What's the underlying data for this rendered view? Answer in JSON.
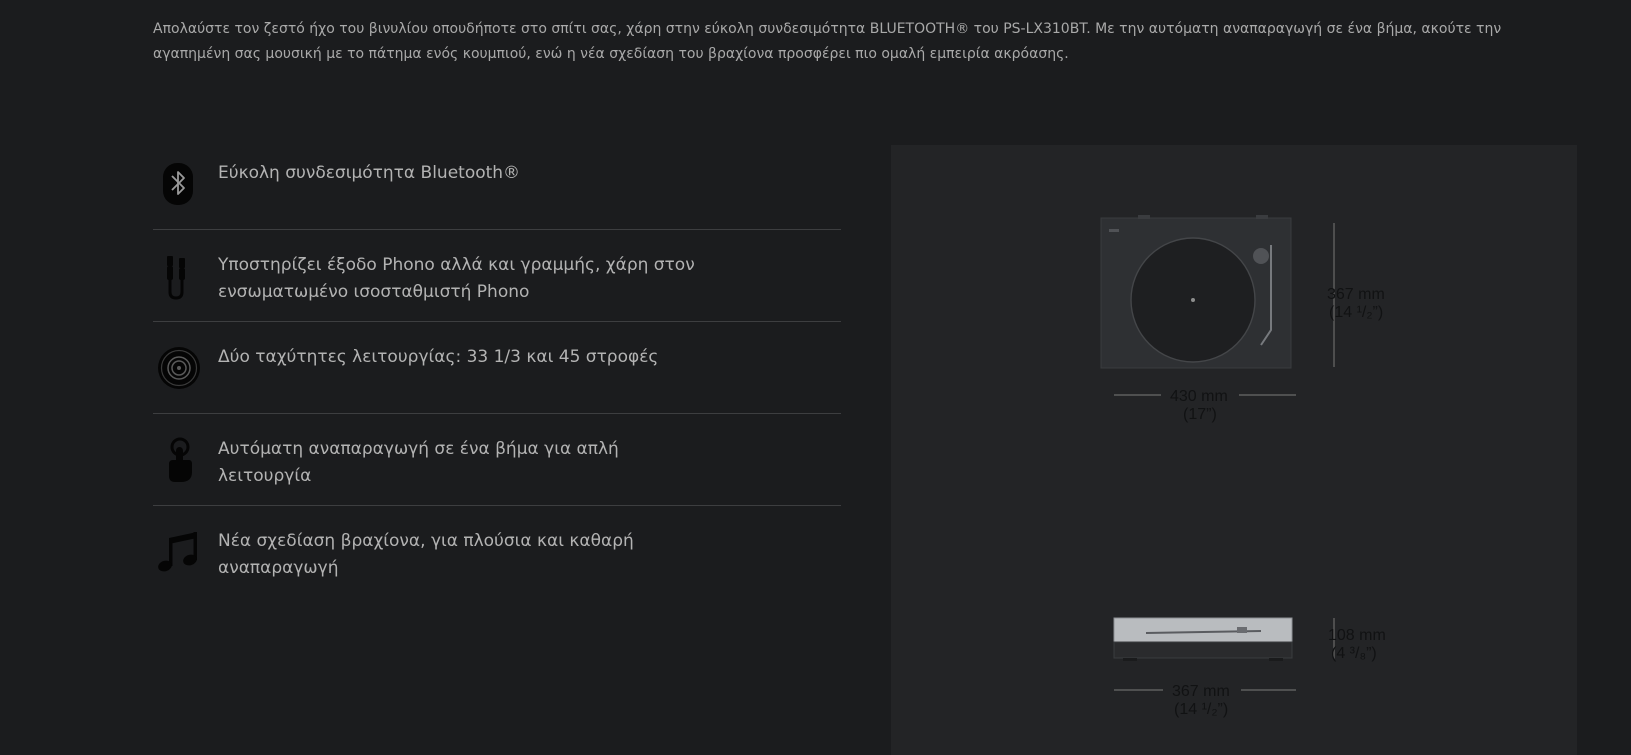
{
  "intro": {
    "text": "Απολαύστε τον ζεστό ήχο του βινυλίου οπουδήποτε στο σπίτι σας, χάρη στην εύκολη συνδεσιμότητα BLUETOOTH® του PS-LX310BT. Με την αυτόματη αναπαραγωγή σε ένα βήμα, ακούτε την αγαπημένη σας μουσική με το πάτημα ενός κουμπιού, ενώ η νέα σχεδίαση του βραχίονα προσφέρει πιο ομαλή εμπειρία ακρόασης."
  },
  "features": [
    {
      "icon": "bluetooth-icon",
      "text": "Εύκολη συνδεσιμότητα Bluetooth®"
    },
    {
      "icon": "phono-cable-icon",
      "text": "Υποστηρίζει έξοδο Phono αλλά και γραμμής, χάρη στον ενσωματωμένο ισοσταθμιστή Phono"
    },
    {
      "icon": "record-disc-icon",
      "text": "Δύο ταχύτητες λειτουργίας: 33 1/3 και 45 στροφές"
    },
    {
      "icon": "press-hand-icon",
      "text": "Αυτόματη αναπαραγωγή σε ένα βήμα για απλή λειτουργία"
    },
    {
      "icon": "music-note-icon",
      "text": "Νέα σχεδίαση βραχίονα, για πλούσια και καθαρή αναπαραγωγή"
    }
  ],
  "dimensions": {
    "top_height": "367 mm",
    "top_height_in": "(14 ¹/₂”)",
    "top_width": "430 mm",
    "top_width_in": "(17”)",
    "side_height": "108 mm",
    "side_height_in": "(4 ³/₈”)",
    "side_depth": "367 mm",
    "side_depth_in": "(14 ¹/₂”)"
  }
}
